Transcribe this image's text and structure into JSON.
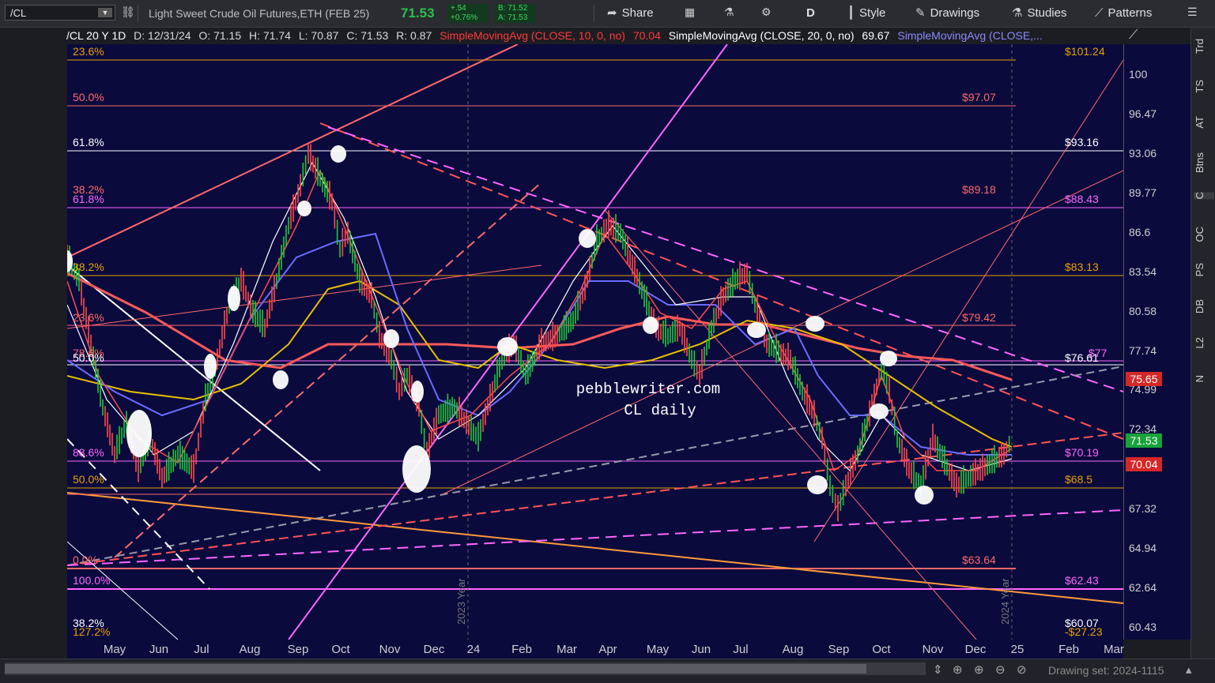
{
  "toolbar": {
    "symbol": "/CL",
    "description": "Light Sweet Crude Oil Futures,ETH (FEB 25)",
    "last_price": "71.53",
    "net_change": "+.54",
    "pct_change": "+0.76%",
    "bid": "B: 71.52",
    "ask": "A: 71.53",
    "share": "Share",
    "period": "D",
    "style": "Style",
    "drawings": "Drawings",
    "studies": "Studies",
    "patterns": "Patterns"
  },
  "infobar": {
    "chart_label": "/CL 20 Y 1D",
    "date": "D: 12/31/24",
    "open": "O: 71.15",
    "high": "H: 71.74",
    "low": "L: 70.87",
    "close": "C: 71.53",
    "range": "R: 0.87",
    "sma10_label": "SimpleMovingAvg (CLOSE, 10, 0, no)",
    "sma10_value": "70.04",
    "sma20_label": "SimpleMovingAvg (CLOSE, 20, 0, no)",
    "sma20_value": "69.67",
    "sma3_label": "SimpleMovingAvg (CLOSE,..."
  },
  "colors": {
    "price_up": "#22c83a",
    "price_down": "#ff4a4a",
    "sma10": "#ff4a4a",
    "sma20": "#ffffff",
    "sma50": "#6b6bff",
    "sma100": "#e8c000",
    "sma200": "#ff5a5a",
    "chart_bg": "#0a0a3d"
  },
  "watermark": {
    "line1": "pebblewriter.com",
    "line2": "CL daily"
  },
  "year_labels": [
    "2023 Year",
    "2024 Year"
  ],
  "fib_labels_left": [
    {
      "text": "23.6%",
      "color": "#e8a000"
    },
    {
      "text": "50.0%",
      "color": "#ff6a6a"
    },
    {
      "text": "61.8%",
      "color": "#ffffff"
    },
    {
      "text": "38.2%",
      "color": "#ff6a6a"
    },
    {
      "text": "61.8%",
      "color": "#ff66ff"
    },
    {
      "text": "38.2%",
      "color": "#e8a000"
    },
    {
      "text": "23.6%",
      "color": "#ff6a6a"
    },
    {
      "text": "78.6%",
      "color": "#ff6a6a"
    },
    {
      "text": "50.0%",
      "color": "#ffffff"
    },
    {
      "text": "88.6%",
      "color": "#ff66ff"
    },
    {
      "text": "50.0%",
      "color": "#e8a000"
    },
    {
      "text": "0.0%",
      "color": "#ff6a6a"
    },
    {
      "text": "100.0%",
      "color": "#ff66ff"
    },
    {
      "text": "38.2%",
      "color": "#ffffff"
    },
    {
      "text": "127.2%",
      "color": "#e8a000"
    }
  ],
  "fib_labels_right": [
    {
      "text": "$101.24",
      "color": "#e8a000"
    },
    {
      "text": "$97.07",
      "color": "#ff6a6a"
    },
    {
      "text": "$93.16",
      "color": "#ffffff"
    },
    {
      "text": "$89.18",
      "color": "#ff6a6a"
    },
    {
      "text": "$88.43",
      "color": "#ff66ff"
    },
    {
      "text": "$83.13",
      "color": "#e8a000"
    },
    {
      "text": "$79.42",
      "color": "#ff6a6a"
    },
    {
      "text": "$77",
      "color": "#ff66ff"
    },
    {
      "text": "$76.61",
      "color": "#ffffff"
    },
    {
      "text": "$70.19",
      "color": "#ff66ff"
    },
    {
      "text": "$68.5",
      "color": "#e8a000"
    },
    {
      "text": "$63.64",
      "color": "#ff6a6a"
    },
    {
      "text": "$62.43",
      "color": "#ff66ff"
    },
    {
      "text": "$60.07",
      "color": "#ffffff"
    },
    {
      "text": "-$27.23",
      "color": "#e8a000"
    }
  ],
  "yaxis": {
    "ticks": [
      "100",
      "96.47",
      "93.06",
      "89.77",
      "86.6",
      "83.54",
      "80.58",
      "77.74",
      "74.99",
      "72.34",
      "69.8",
      "67.32",
      "64.94",
      "62.64",
      "60.43"
    ],
    "badges": [
      {
        "text": "75.65",
        "color": "#d42828"
      },
      {
        "text": "71.53",
        "color": "#19a33a"
      },
      {
        "text": "70.04",
        "color": "#d42828"
      }
    ]
  },
  "xaxis": {
    "ticks": [
      "May",
      "Jun",
      "Jul",
      "Aug",
      "Sep",
      "Oct",
      "Nov",
      "Dec",
      "24",
      "Feb",
      "Mar",
      "Apr",
      "May",
      "Jun",
      "Jul",
      "Aug",
      "Sep",
      "Oct",
      "Nov",
      "Dec",
      "25",
      "Feb",
      "Mar"
    ]
  },
  "right_tabs": [
    "Trd",
    "TS",
    "AT",
    "Btns",
    "C",
    "OC",
    "PS",
    "DB",
    "L2",
    "N"
  ],
  "status": {
    "drawing_set": "Drawing set: 2024-1115"
  }
}
